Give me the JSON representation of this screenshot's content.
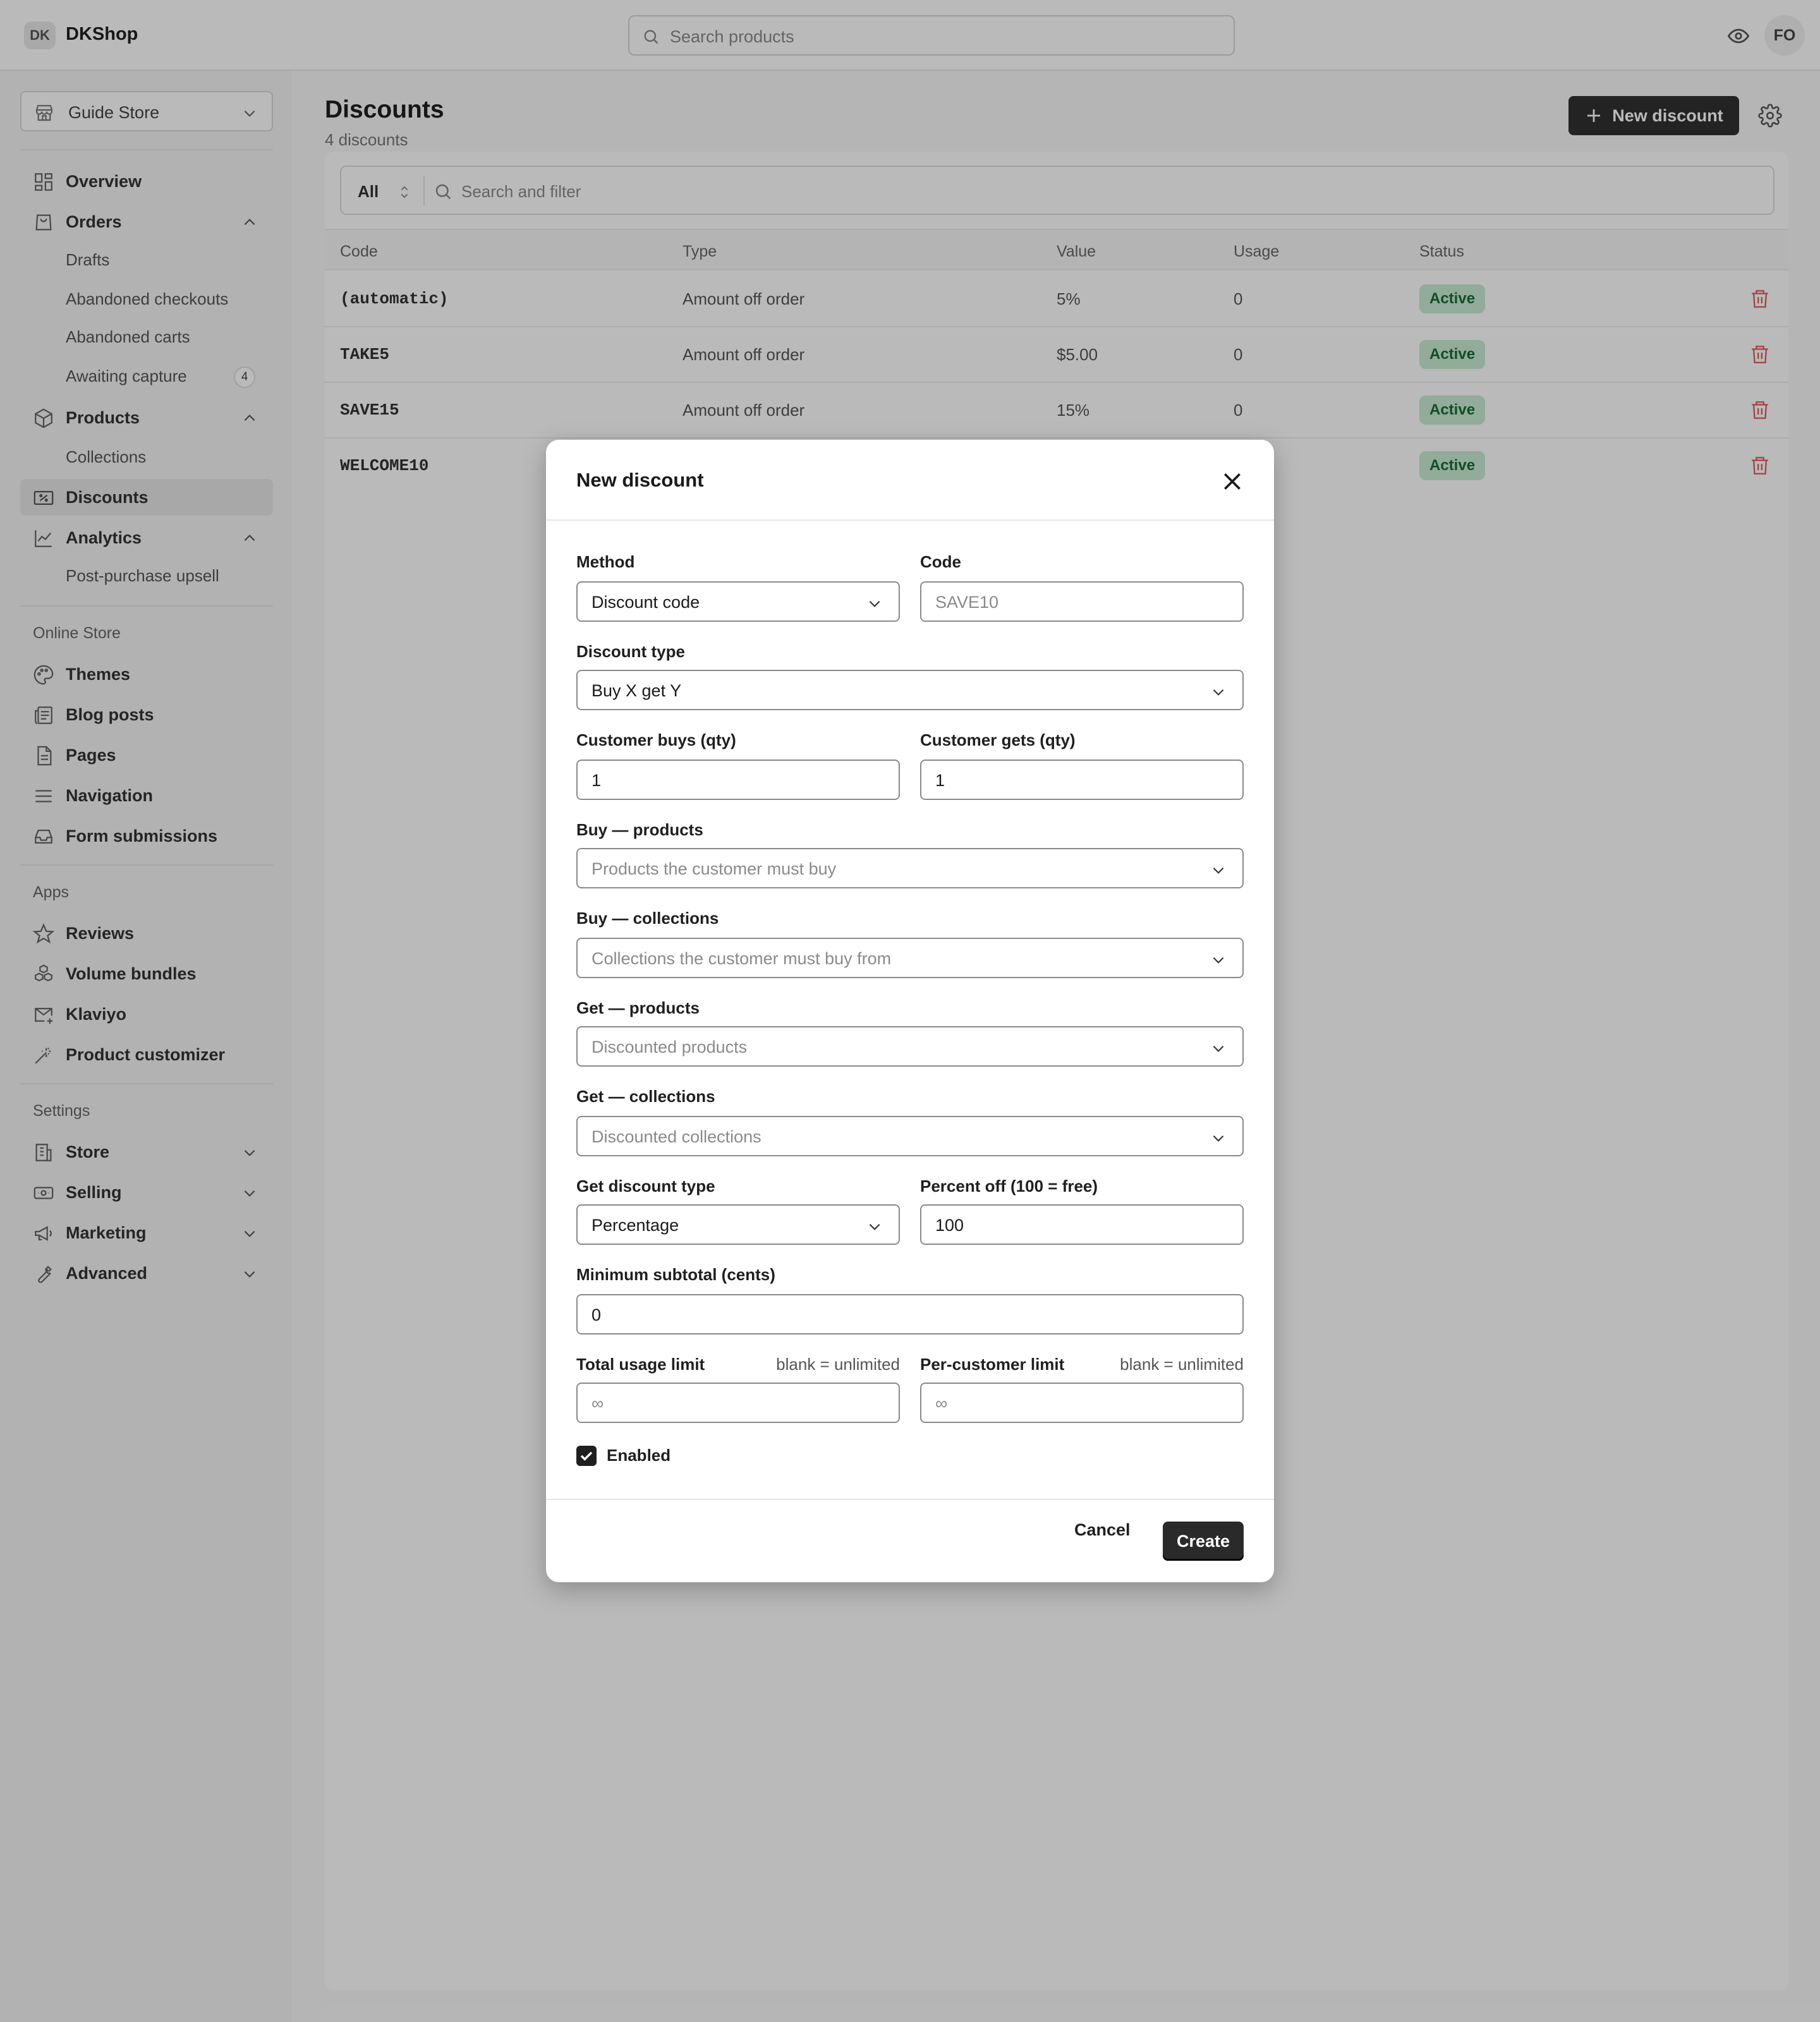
{
  "topbar": {
    "logo_initials": "DK",
    "brand": "DKShop",
    "search_placeholder": "Search products",
    "avatar_initials": "FO"
  },
  "sidebar": {
    "store_name": "Guide Store",
    "items": {
      "overview": "Overview",
      "orders": "Orders",
      "drafts": "Drafts",
      "abandoned_checkouts": "Abandoned checkouts",
      "abandoned_carts": "Abandoned carts",
      "awaiting_capture": "Awaiting capture",
      "awaiting_capture_count": "4",
      "products": "Products",
      "collections": "Collections",
      "discounts": "Discounts",
      "analytics": "Analytics",
      "post_purchase_upsell": "Post-purchase upsell"
    },
    "online_store": {
      "heading": "Online Store",
      "themes": "Themes",
      "blog_posts": "Blog posts",
      "pages": "Pages",
      "navigation": "Navigation",
      "form_submissions": "Form submissions"
    },
    "apps": {
      "heading": "Apps",
      "reviews": "Reviews",
      "volume_bundles": "Volume bundles",
      "klaviyo": "Klaviyo",
      "product_customizer": "Product customizer"
    },
    "settings": {
      "heading": "Settings",
      "store": "Store",
      "selling": "Selling",
      "marketing": "Marketing",
      "advanced": "Advanced"
    }
  },
  "main": {
    "title": "Discounts",
    "subtitle": "4 discounts",
    "new_button": "New discount",
    "filter_all": "All",
    "filter_placeholder": "Search and filter",
    "columns": [
      "Code",
      "Type",
      "Value",
      "Usage",
      "Status"
    ],
    "rows": [
      {
        "code": "(automatic)",
        "type": "Amount off order",
        "value": "5%",
        "usage": "0",
        "status": "Active"
      },
      {
        "code": "TAKE5",
        "type": "Amount off order",
        "value": "$5.00",
        "usage": "0",
        "status": "Active"
      },
      {
        "code": "SAVE15",
        "type": "Amount off order",
        "value": "15%",
        "usage": "0",
        "status": "Active"
      },
      {
        "code": "WELCOME10",
        "type": "",
        "value": "",
        "usage": "",
        "status": "Active"
      }
    ]
  },
  "modal": {
    "title": "New discount",
    "method_label": "Method",
    "method_value": "Discount code",
    "code_label": "Code",
    "code_placeholder": "SAVE10",
    "discount_type_label": "Discount type",
    "discount_type_value": "Buy X get Y",
    "buys_label": "Customer buys (qty)",
    "buys_value": "1",
    "gets_label": "Customer gets (qty)",
    "gets_value": "1",
    "buy_products_label": "Buy — products",
    "buy_products_placeholder": "Products the customer must buy",
    "buy_collections_label": "Buy — collections",
    "buy_collections_placeholder": "Collections the customer must buy from",
    "get_products_label": "Get — products",
    "get_products_placeholder": "Discounted products",
    "get_collections_label": "Get — collections",
    "get_collections_placeholder": "Discounted collections",
    "get_discount_type_label": "Get discount type",
    "get_discount_type_value": "Percentage",
    "percent_off_label": "Percent off (100 = free)",
    "percent_off_value": "100",
    "min_subtotal_label": "Minimum subtotal (cents)",
    "min_subtotal_value": "0",
    "total_limit_label": "Total usage limit",
    "total_limit_hint": "blank = unlimited",
    "total_limit_placeholder": "∞",
    "per_customer_label": "Per-customer limit",
    "per_customer_hint": "blank = unlimited",
    "per_customer_placeholder": "∞",
    "enabled_label": "Enabled",
    "enabled_checked": true,
    "cancel_label": "Cancel",
    "create_label": "Create"
  },
  "colors": {
    "active_badge_bg": "#c9ebd3",
    "active_badge_text": "#1a6b35",
    "trash": "#e05a5a",
    "primary_button": "#2a2a2a"
  }
}
